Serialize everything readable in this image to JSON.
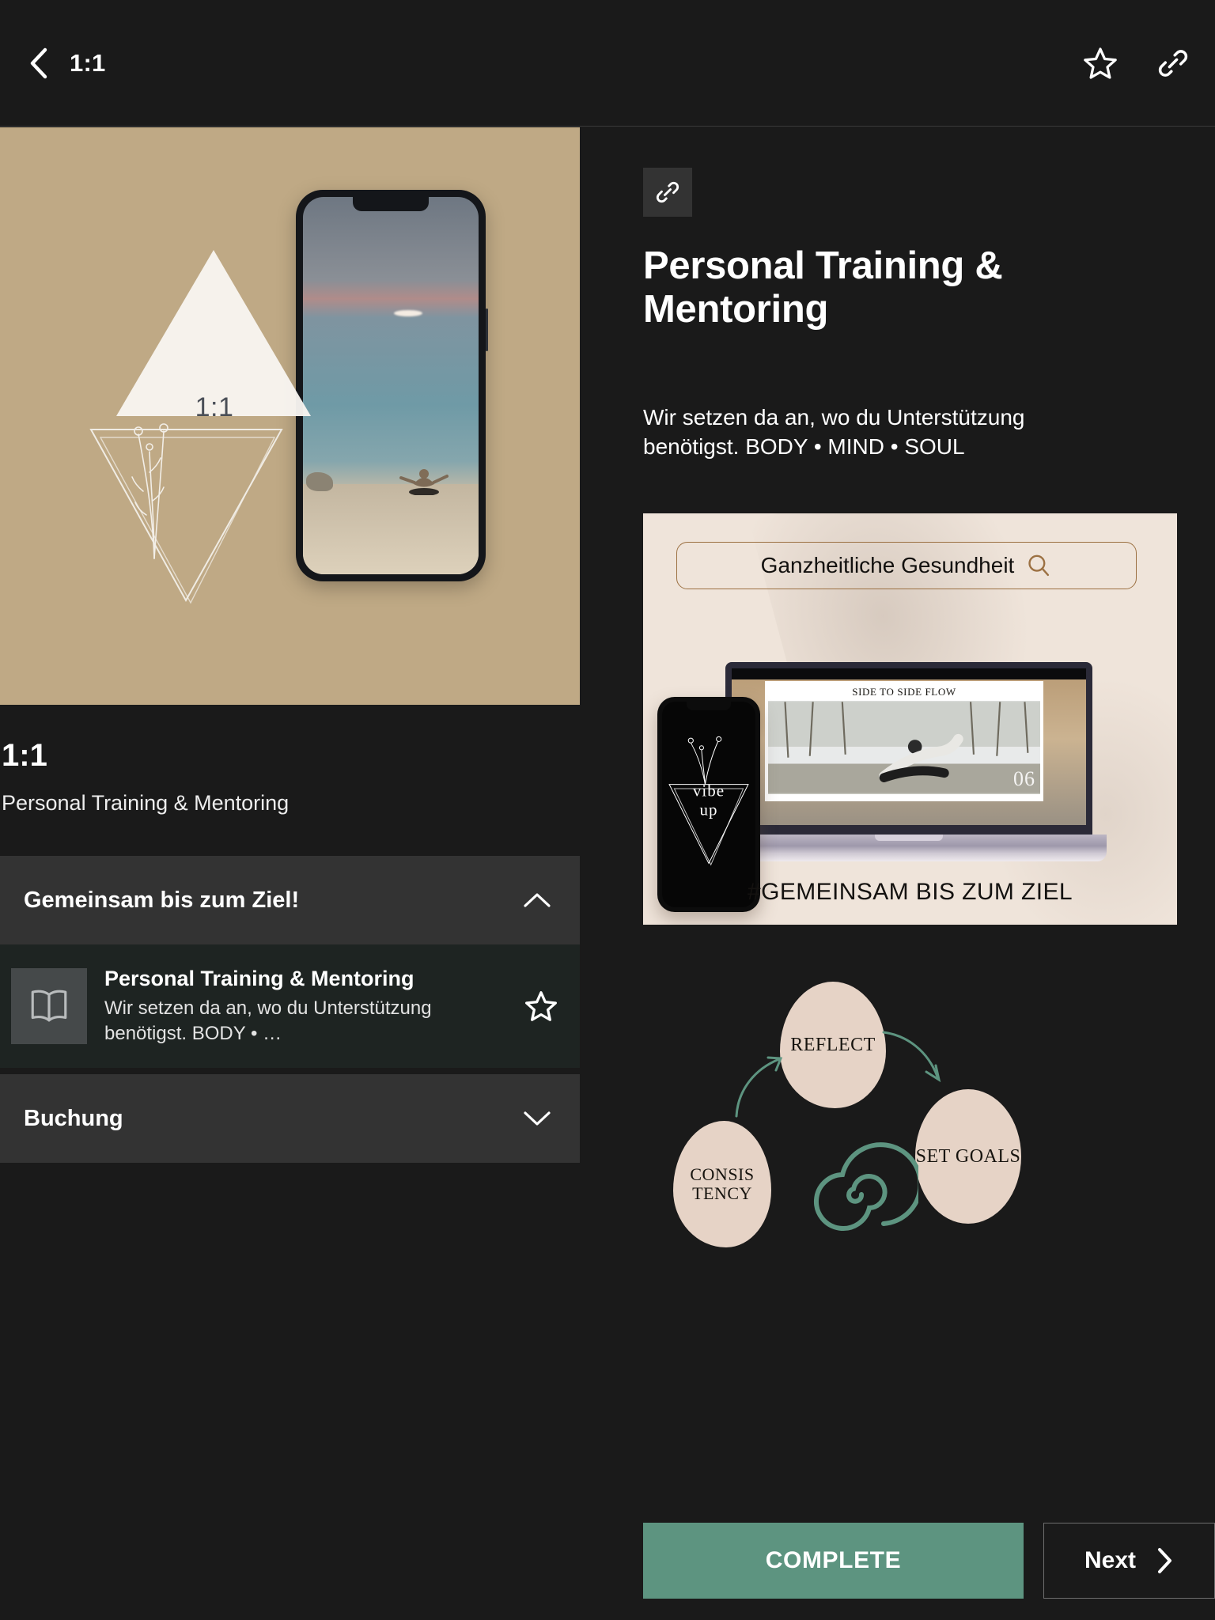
{
  "topbar": {
    "back_icon": "chevron-left-icon",
    "title": "1:1",
    "favorite_icon": "star-icon",
    "link_icon": "link-icon"
  },
  "left": {
    "hero": {
      "ratio_label": "1:1",
      "background_color": "#bfa985"
    },
    "title": "1:1",
    "subtitle": "Personal Training & Mentoring",
    "sections": [
      {
        "label": "Gemeinsam bis zum Ziel!",
        "state": "expanded",
        "chevron": "chevron-up-icon"
      },
      {
        "label": "Buchung",
        "state": "collapsed",
        "chevron": "chevron-down-icon"
      }
    ],
    "list_item": {
      "icon": "book-icon",
      "title": "Personal Training & Mentoring",
      "description": "Wir setzen da an, wo du Unterstützung benötigst. BODY • …",
      "star_icon": "star-icon"
    }
  },
  "detail": {
    "link_chip_icon": "link-icon",
    "title": "Personal Training & Mentoring",
    "description": "Wir setzen da an, wo du Unterstützung benötigst. BODY • MIND • SOUL",
    "promo": {
      "search_text": "Ganzheitliche Gesundheit",
      "search_icon": "search-icon",
      "laptop_caption": "SIDE TO SIDE FLOW",
      "laptop_number": "06",
      "phone_logo_line1": "vibe",
      "phone_logo_line2": "up",
      "tagline": "#GEMEINSAM BIS ZUM ZIEL"
    },
    "cycle": {
      "reflect": "REFLECT",
      "set_goals": "SET GOALS",
      "consistency": "CONSIS TENCY",
      "accent_color": "#5d9480",
      "blob_color": "#e6d3c6"
    }
  },
  "actions": {
    "complete_label": "COMPLETE",
    "next_label": "Next",
    "next_icon": "chevron-right-icon",
    "complete_color": "#5d9480"
  }
}
